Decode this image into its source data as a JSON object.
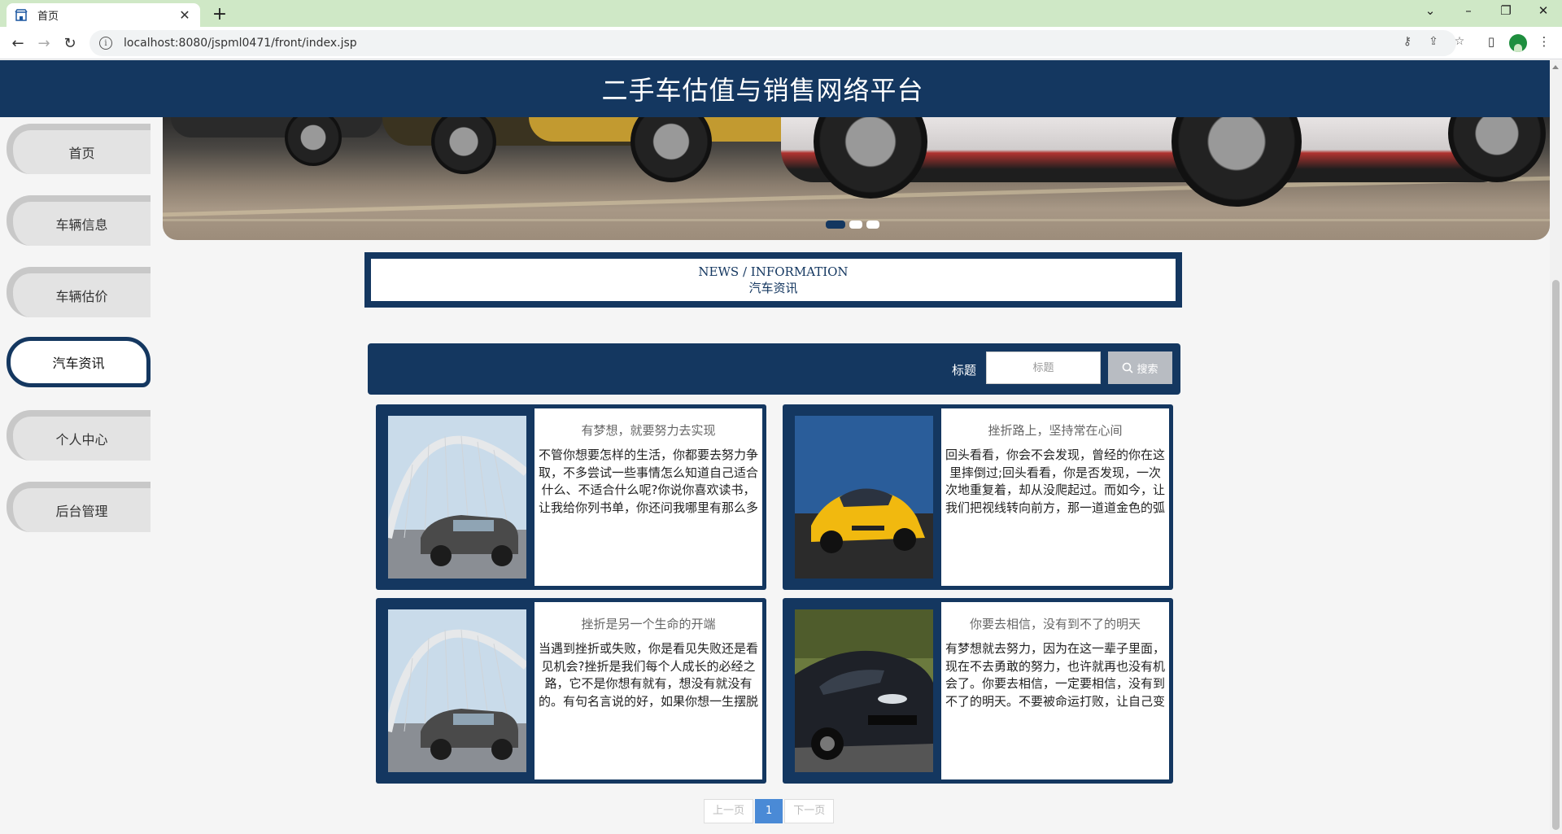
{
  "browser": {
    "tab_title": "首页",
    "url": "localhost:8080/jspml0471/front/index.jsp"
  },
  "site": {
    "title": "二手车估值与销售网络平台"
  },
  "sidebar": {
    "items": [
      {
        "label": "首页"
      },
      {
        "label": "车辆信息"
      },
      {
        "label": "车辆估价"
      },
      {
        "label": "汽车资讯"
      },
      {
        "label": "个人中心"
      },
      {
        "label": "后台管理"
      }
    ],
    "active": "汽车资讯"
  },
  "banner": {
    "slide_count": 3,
    "active_slide": 1
  },
  "section": {
    "title_en": "NEWS / INFORMATION",
    "title_cn": "汽车资讯"
  },
  "search": {
    "label": "标题",
    "placeholder": "标题",
    "button": "搜索"
  },
  "news": [
    {
      "title": "有梦想，就要努力去实现",
      "desc": "不管你想要怎样的生活，你都要去努力争取，不多尝试一些事情怎么知道自己适合什么、不适合什么呢?你说你喜欢读书，让我给你列书单，你还问我哪里有那么多时间看书;你说自己梦想的…",
      "image": "silver-sedan-bridge"
    },
    {
      "title": "挫折路上，坚持常在心间",
      "desc": "回头看看，你会不会发现，曾经的你在这里摔倒过;回头看看，你是否发现，一次次地重复着，却从没爬起过。而如今，让我们把视线转向前方，那一道道金色的弧线，是流星飞逝的痕迹，或…",
      "image": "yellow-sports-car"
    },
    {
      "title": "挫折是另一个生命的开端",
      "desc": "当遇到挫折或失败，你是看见失败还是看见机会?挫折是我们每个人成长的必经之路，它不是你想有就有，想没有就没有的。有句名言说的好，如果你想一生摆脱苦难，你就得是神或者是死尸…",
      "image": "silver-sedan-bridge"
    },
    {
      "title": "你要去相信，没有到不了的明天",
      "desc": "有梦想就去努力，因为在这一辈子里面，现在不去勇敢的努力，也许就再也没有机会了。你要去相信，一定要相信，没有到不了的明天。不要被命运打败，让自己变得更强大。不管你现在…",
      "image": "dark-sports-car"
    }
  ],
  "pagination": {
    "prev": "上一页",
    "current": "1",
    "next": "下一页"
  }
}
